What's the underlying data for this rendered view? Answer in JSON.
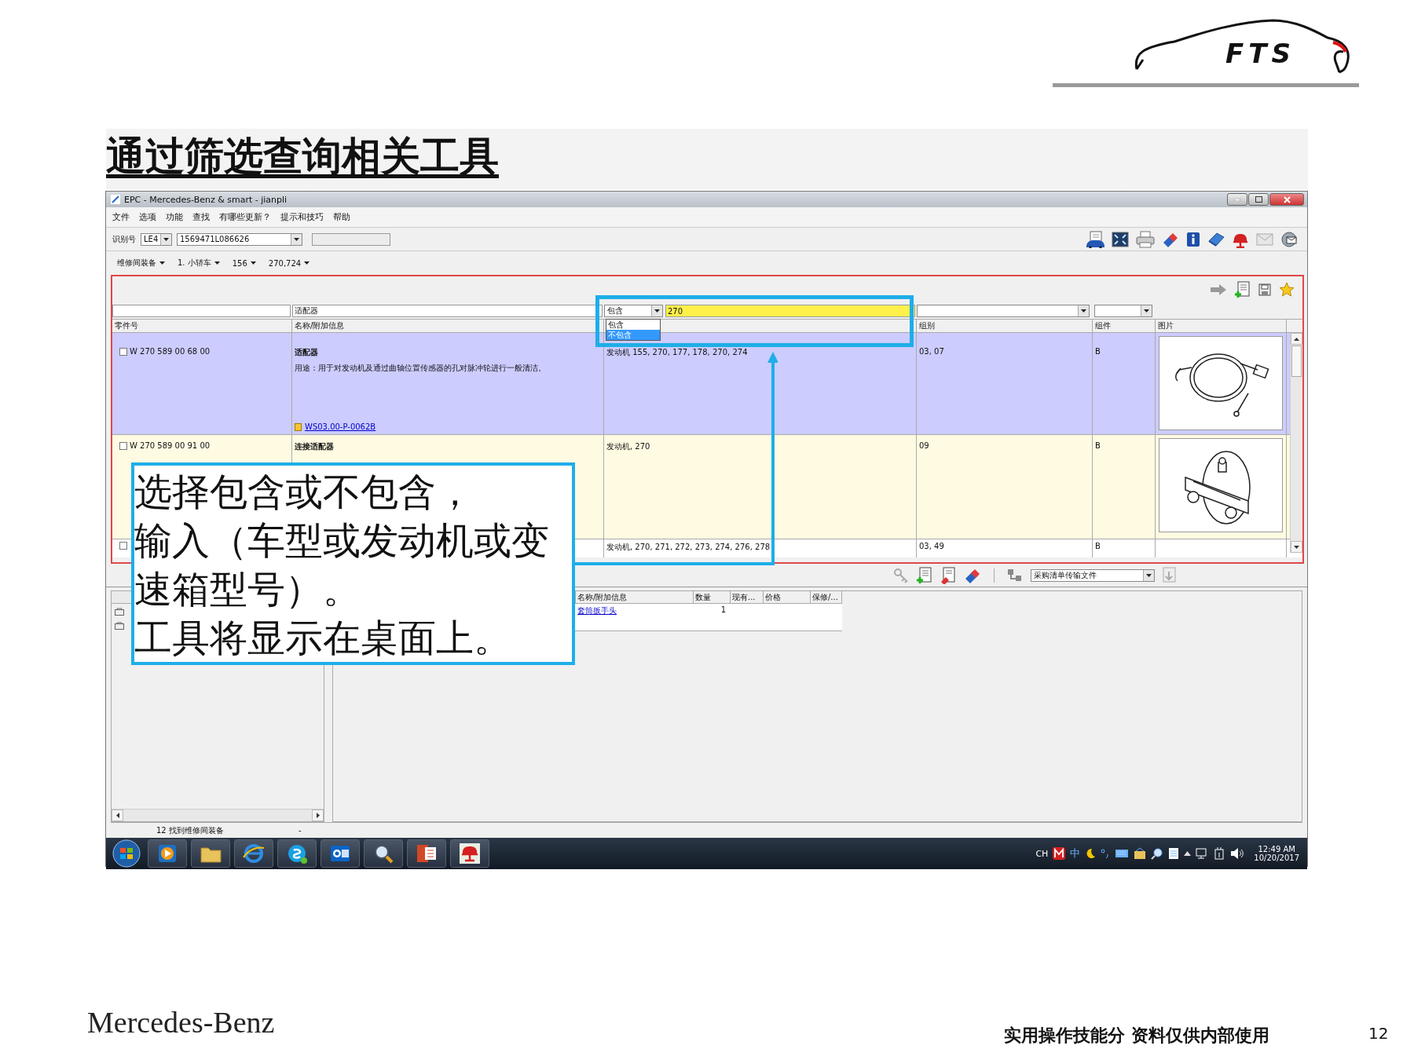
{
  "slide": {
    "title": "通过筛选查询相关工具",
    "logo_text": "FTS",
    "brand": "Mercedes-Benz",
    "footer_note": "实用操作技能分 资料仅供内部使用",
    "page_number": "12"
  },
  "window": {
    "title": "EPC - Mercedes-Benz & smart - jianpli"
  },
  "menu": [
    "文件",
    "选项",
    "功能",
    "查找",
    "有哪些更新？",
    "提示和技巧",
    "帮助"
  ],
  "id_bar": {
    "label": "识别号",
    "type": "LE4",
    "number": "1569471L086626"
  },
  "breadcrumb": [
    "维修间装备",
    "1. 小轿车",
    "156",
    "270,724"
  ],
  "filters": {
    "name": "适配器",
    "match_mode": "包含",
    "match_value": "270",
    "options": [
      {
        "label": "包含",
        "selected": false
      },
      {
        "label": "不包含",
        "selected": true
      }
    ]
  },
  "column_headers": {
    "part_number": "零件号",
    "name": "名称/附加信息",
    "group": "组别",
    "component": "组件",
    "picture": "图片"
  },
  "rows": [
    {
      "checked": false,
      "part_number": "W 270 589 00 68 00",
      "name": "适配器",
      "description": "用途：用于对发动机及通过曲轴位置传感器的孔对脉冲轮进行一般清洁。",
      "link": "WS03.00-P-0062B",
      "applicability": "发动机 155, 270, 177, 178, 270, 274",
      "group": "03, 07",
      "component": "B",
      "selected": true,
      "highlighted": false,
      "kind": "cable"
    },
    {
      "checked": false,
      "part_number": "W 270 589 00 91 00",
      "name": "连接适配器",
      "applicability": "发动机, 270",
      "group": "09",
      "component": "B",
      "selected": false,
      "highlighted": true,
      "kind": "disc"
    },
    {
      "checked": false,
      "applicability": "发动机, 270, 271, 272, 273, 274, 276, 278",
      "group": "03, 49",
      "component": "B",
      "selected": false,
      "highlighted": false
    }
  ],
  "basket": {
    "dropdown": "采购清单传输文件",
    "columns": [
      "名称/附加信息",
      "数量",
      "现有...",
      "价格",
      "保修/..."
    ],
    "rows": [
      {
        "name": "套筒扳手头",
        "quantity": "1"
      }
    ]
  },
  "status_bar": {
    "count": "12 找到维修间装备",
    "extra": "-"
  },
  "callout": {
    "lines": [
      "选择包含或不包含，",
      "输入（车型或发动机或变",
      "速箱型号）。",
      "工具将显示在桌面上。"
    ]
  },
  "taskbar": {
    "language": "CH",
    "ime": "中",
    "time": "12:49 AM",
    "date": "10/20/2017"
  }
}
